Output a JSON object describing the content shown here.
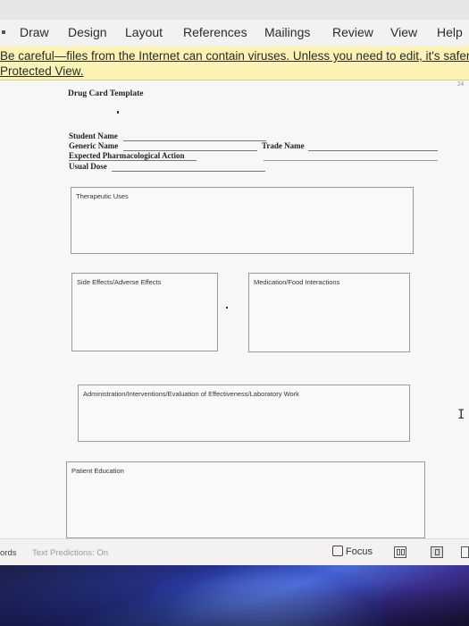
{
  "ribbon": {
    "tabs": [
      "Draw",
      "Design",
      "Layout",
      "References",
      "Mailings",
      "Review",
      "View",
      "Help"
    ]
  },
  "protected_view": {
    "line1": "Be careful—files from the Internet can contain viruses. Unless you need to edit, it's safer to",
    "line2": "Protected View."
  },
  "document": {
    "page_number": "24",
    "title": "Drug Card Template",
    "fields": {
      "student_name": "Student Name",
      "generic_name": "Generic Name",
      "trade_name": "Trade Name",
      "pharm_action": "Expected Pharmacological Action",
      "usual_dose": "Usual Dose"
    },
    "boxes": {
      "therapeutic_uses": "Therapeutic Uses",
      "side_effects": "Side Effects/Adverse Effects",
      "interactions": "Medication/Food Interactions",
      "administration": "Administration/Interventions/Evaluation of Effectiveness/Laboratory Work",
      "patient_education": "Patient Education"
    }
  },
  "status_bar": {
    "words": "ords",
    "text_predictions": "Text Predictions: On",
    "focus": "Focus"
  }
}
